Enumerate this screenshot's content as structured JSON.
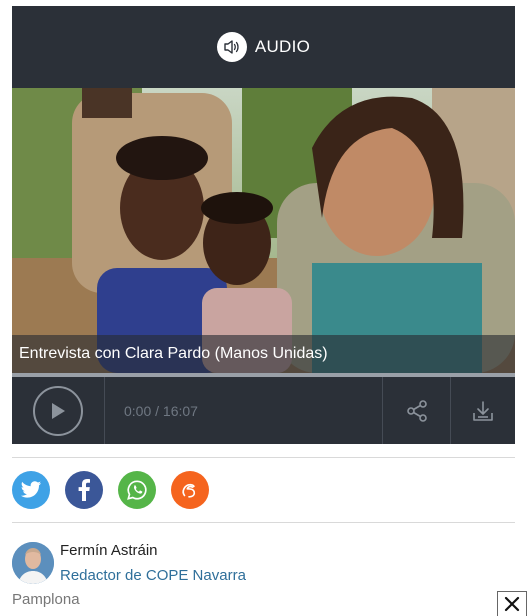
{
  "player": {
    "header_label": "AUDIO",
    "caption": "Entrevista con Clara Pardo (Manos Unidas)",
    "time_display": "0:00 / 16:07",
    "progress": 0
  },
  "social": {
    "items": [
      {
        "name": "twitter",
        "icon": "twitter-icon",
        "color": "#3fa2e6"
      },
      {
        "name": "facebook",
        "icon": "facebook-icon",
        "color": "#3b5798"
      },
      {
        "name": "whatsapp",
        "icon": "whatsapp-icon",
        "color": "#55b548"
      },
      {
        "name": "meneame",
        "icon": "meneame-icon",
        "color": "#f5641e"
      }
    ]
  },
  "author": {
    "name": "Fermín Astráin",
    "role": "Redactor de COPE Navarra",
    "location": "Pamplona"
  },
  "colors": {
    "player_bg": "#2b3038",
    "link": "#2f6f9a"
  }
}
